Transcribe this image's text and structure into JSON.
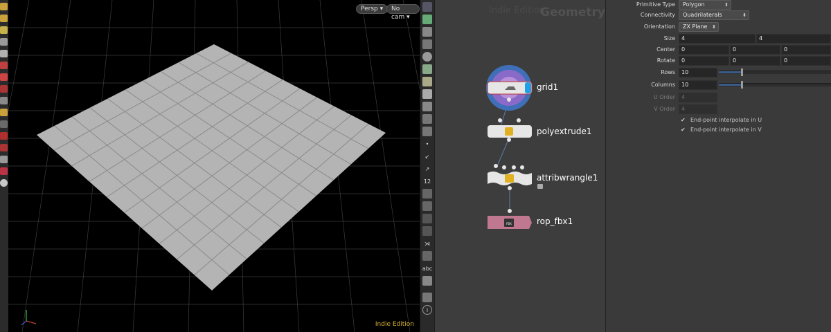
{
  "viewport": {
    "camera_label": "Persp",
    "cam_label": "No cam",
    "watermark": "Indie Edition",
    "grid_rows": 10,
    "grid_columns": 10
  },
  "network": {
    "watermark": "Indie Edition",
    "context_label": "Geometry",
    "nodes": [
      {
        "name": "grid1"
      },
      {
        "name": "polyextrude1"
      },
      {
        "name": "attribwrangle1"
      },
      {
        "name": "rop_fbx1",
        "badge": "FBX"
      }
    ]
  },
  "right_tools": {
    "abc_label": "abc",
    "number_label": "12"
  },
  "parameters": {
    "primitive_type": {
      "label": "Primitive Type",
      "value": "Polygon"
    },
    "connectivity": {
      "label": "Connectivity",
      "value": "Quadrilaterals"
    },
    "orientation": {
      "label": "Orientation",
      "value": "ZX Plane"
    },
    "size": {
      "label": "Size",
      "x": "4",
      "y": "4"
    },
    "center": {
      "label": "Center",
      "x": "0",
      "y": "0",
      "z": "0"
    },
    "rotate": {
      "label": "Rotate",
      "x": "0",
      "y": "0",
      "z": "0"
    },
    "rows": {
      "label": "Rows",
      "value": "10",
      "slider_fraction": 0.2
    },
    "columns": {
      "label": "Columns",
      "value": "10",
      "slider_fraction": 0.2
    },
    "u_order": {
      "label": "U Order",
      "value": "4"
    },
    "v_order": {
      "label": "V Order",
      "value": "4"
    },
    "interp_u": {
      "label": "End-point interpolate in U",
      "checked": true
    },
    "interp_v": {
      "label": "End-point interpolate in V",
      "checked": true
    }
  },
  "colors": {
    "grid_fill": "#b4b4b4",
    "viewport_bg": "#000000",
    "node_selected_ring": "#3f6fb8",
    "node_wrangle_accent": "#e0b020",
    "rop_node": "#c07890",
    "slider_fill": "#3a5b86",
    "watermark": "#d8b435"
  }
}
